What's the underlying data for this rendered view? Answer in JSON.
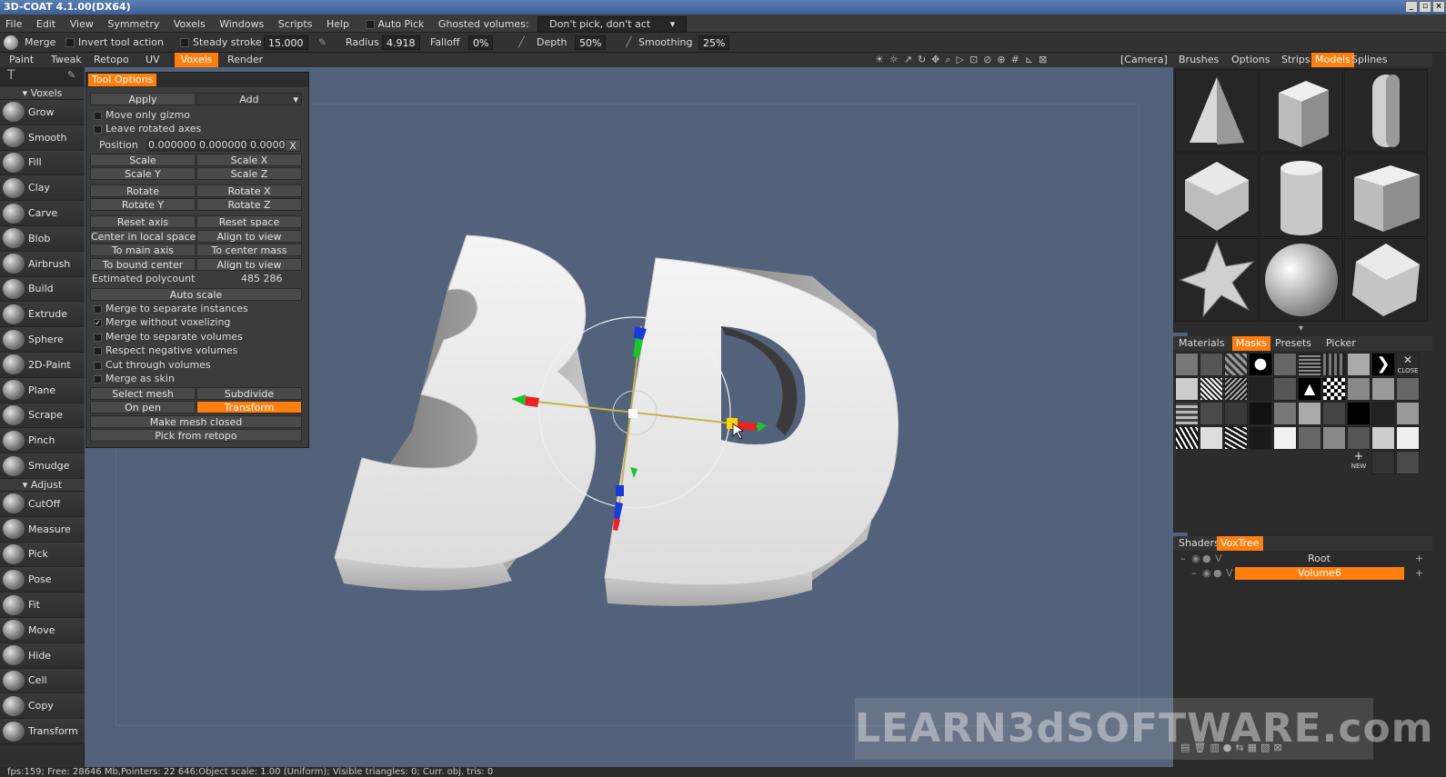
{
  "title": "3D-COAT 4.1.00(DX64)",
  "menu": [
    "File",
    "Edit",
    "View",
    "Symmetry",
    "Voxels",
    "Windows",
    "Scripts",
    "Help"
  ],
  "auto_pick": "Auto Pick",
  "ghosted_label": "Ghosted volumes:",
  "ghosted_value": "Don't pick, don't act",
  "toolbar": {
    "merge": "Merge",
    "invert": "Invert tool action",
    "steady": "Steady stroke",
    "steady_val": "15.000",
    "radius": "Radius",
    "radius_val": "4.918",
    "falloff": "Falloff",
    "falloff_val": "0%",
    "depth": "Depth",
    "depth_val": "50%",
    "smoothing": "Smoothing",
    "smoothing_val": "25%",
    "camera": "[Camera]"
  },
  "rooms": [
    "Paint",
    "Tweak",
    "Retopo",
    "UV",
    "Voxels",
    "Render"
  ],
  "active_room": "Voxels",
  "left_panel": {
    "voxels_header": "Voxels",
    "voxel_tools": [
      "Grow",
      "Smooth",
      "Fill",
      "Clay",
      "Carve",
      "Blob",
      "Airbrush",
      "Build",
      "Extrude",
      "Sphere",
      "2D-Paint",
      "Plane",
      "Scrape",
      "Pinch",
      "Smudge"
    ],
    "adjust_header": "Adjust",
    "adjust_tools": [
      "CutOff",
      "Measure",
      "Pick",
      "Pose",
      "Fit",
      "Move",
      "Hide",
      "Cell",
      "Copy",
      "Transform"
    ]
  },
  "tool_options": {
    "tab": "Tool Options",
    "apply": "Apply",
    "add": "Add",
    "move_only_gizmo": "Move only gizmo",
    "leave_rotated": "Leave rotated axes",
    "position_label": "Position",
    "position_value": "0.000000  0.000000  0.000000",
    "x": "X",
    "scale": "Scale",
    "scale_x": "Scale  X",
    "scale_y": "Scale  Y",
    "scale_z": "Scale  Z",
    "rotate": "Rotate",
    "rotate_x": "Rotate  X",
    "rotate_y": "Rotate  Y",
    "rotate_z": "Rotate  Z",
    "reset_axis": "Reset axis",
    "reset_space": "Reset space",
    "center_local": "Center in local space",
    "align_view1": "Align to view",
    "to_main_axis": "To main axis",
    "to_center_mass": "To center mass",
    "to_bound_center": "To bound center",
    "align_view2": "Align to view",
    "est_poly_label": "Estimated polycount",
    "est_poly_val": "485 286",
    "auto_scale": "Auto scale",
    "merge_sep_inst": "Merge to separate instances",
    "merge_no_vox": "Merge without voxelizing",
    "merge_sep_vol": "Merge to separate volumes",
    "respect_neg": "Respect negative volumes",
    "cut_through": "Cut through volumes",
    "merge_skin": "Merge as skin",
    "select_mesh": "Select mesh",
    "subdivide": "Subdivide",
    "on_pen": "On pen",
    "transform": "Transform",
    "make_closed": "Make mesh closed",
    "pick_retopo": "Pick from retopo"
  },
  "right_tabs": [
    "Brushes",
    "Options",
    "Strips",
    "Models",
    "Splines"
  ],
  "right_active": "Models",
  "mat_tabs": [
    "Materials",
    "Masks",
    "Presets",
    "Picker"
  ],
  "mat_active": "Masks",
  "mask_close": "CLOSE",
  "mask_new": "NEW",
  "shader_tabs": [
    "Shaders",
    "VoxTree"
  ],
  "shader_active": "VoxTree",
  "voxtree": {
    "root": "Root",
    "volume": "Volume6",
    "vflag": "V"
  },
  "status": "fps:159;  Free: 28646 Mb,Pointers: 22 646;Object scale: 1.00 (Uniform); Visible triangles: 0; Curr. obj. tris: 0",
  "watermark": "LEARN3dSOFTWARE.com",
  "colors": {
    "accent": "#ff7f0e",
    "viewport": "#52627a"
  }
}
